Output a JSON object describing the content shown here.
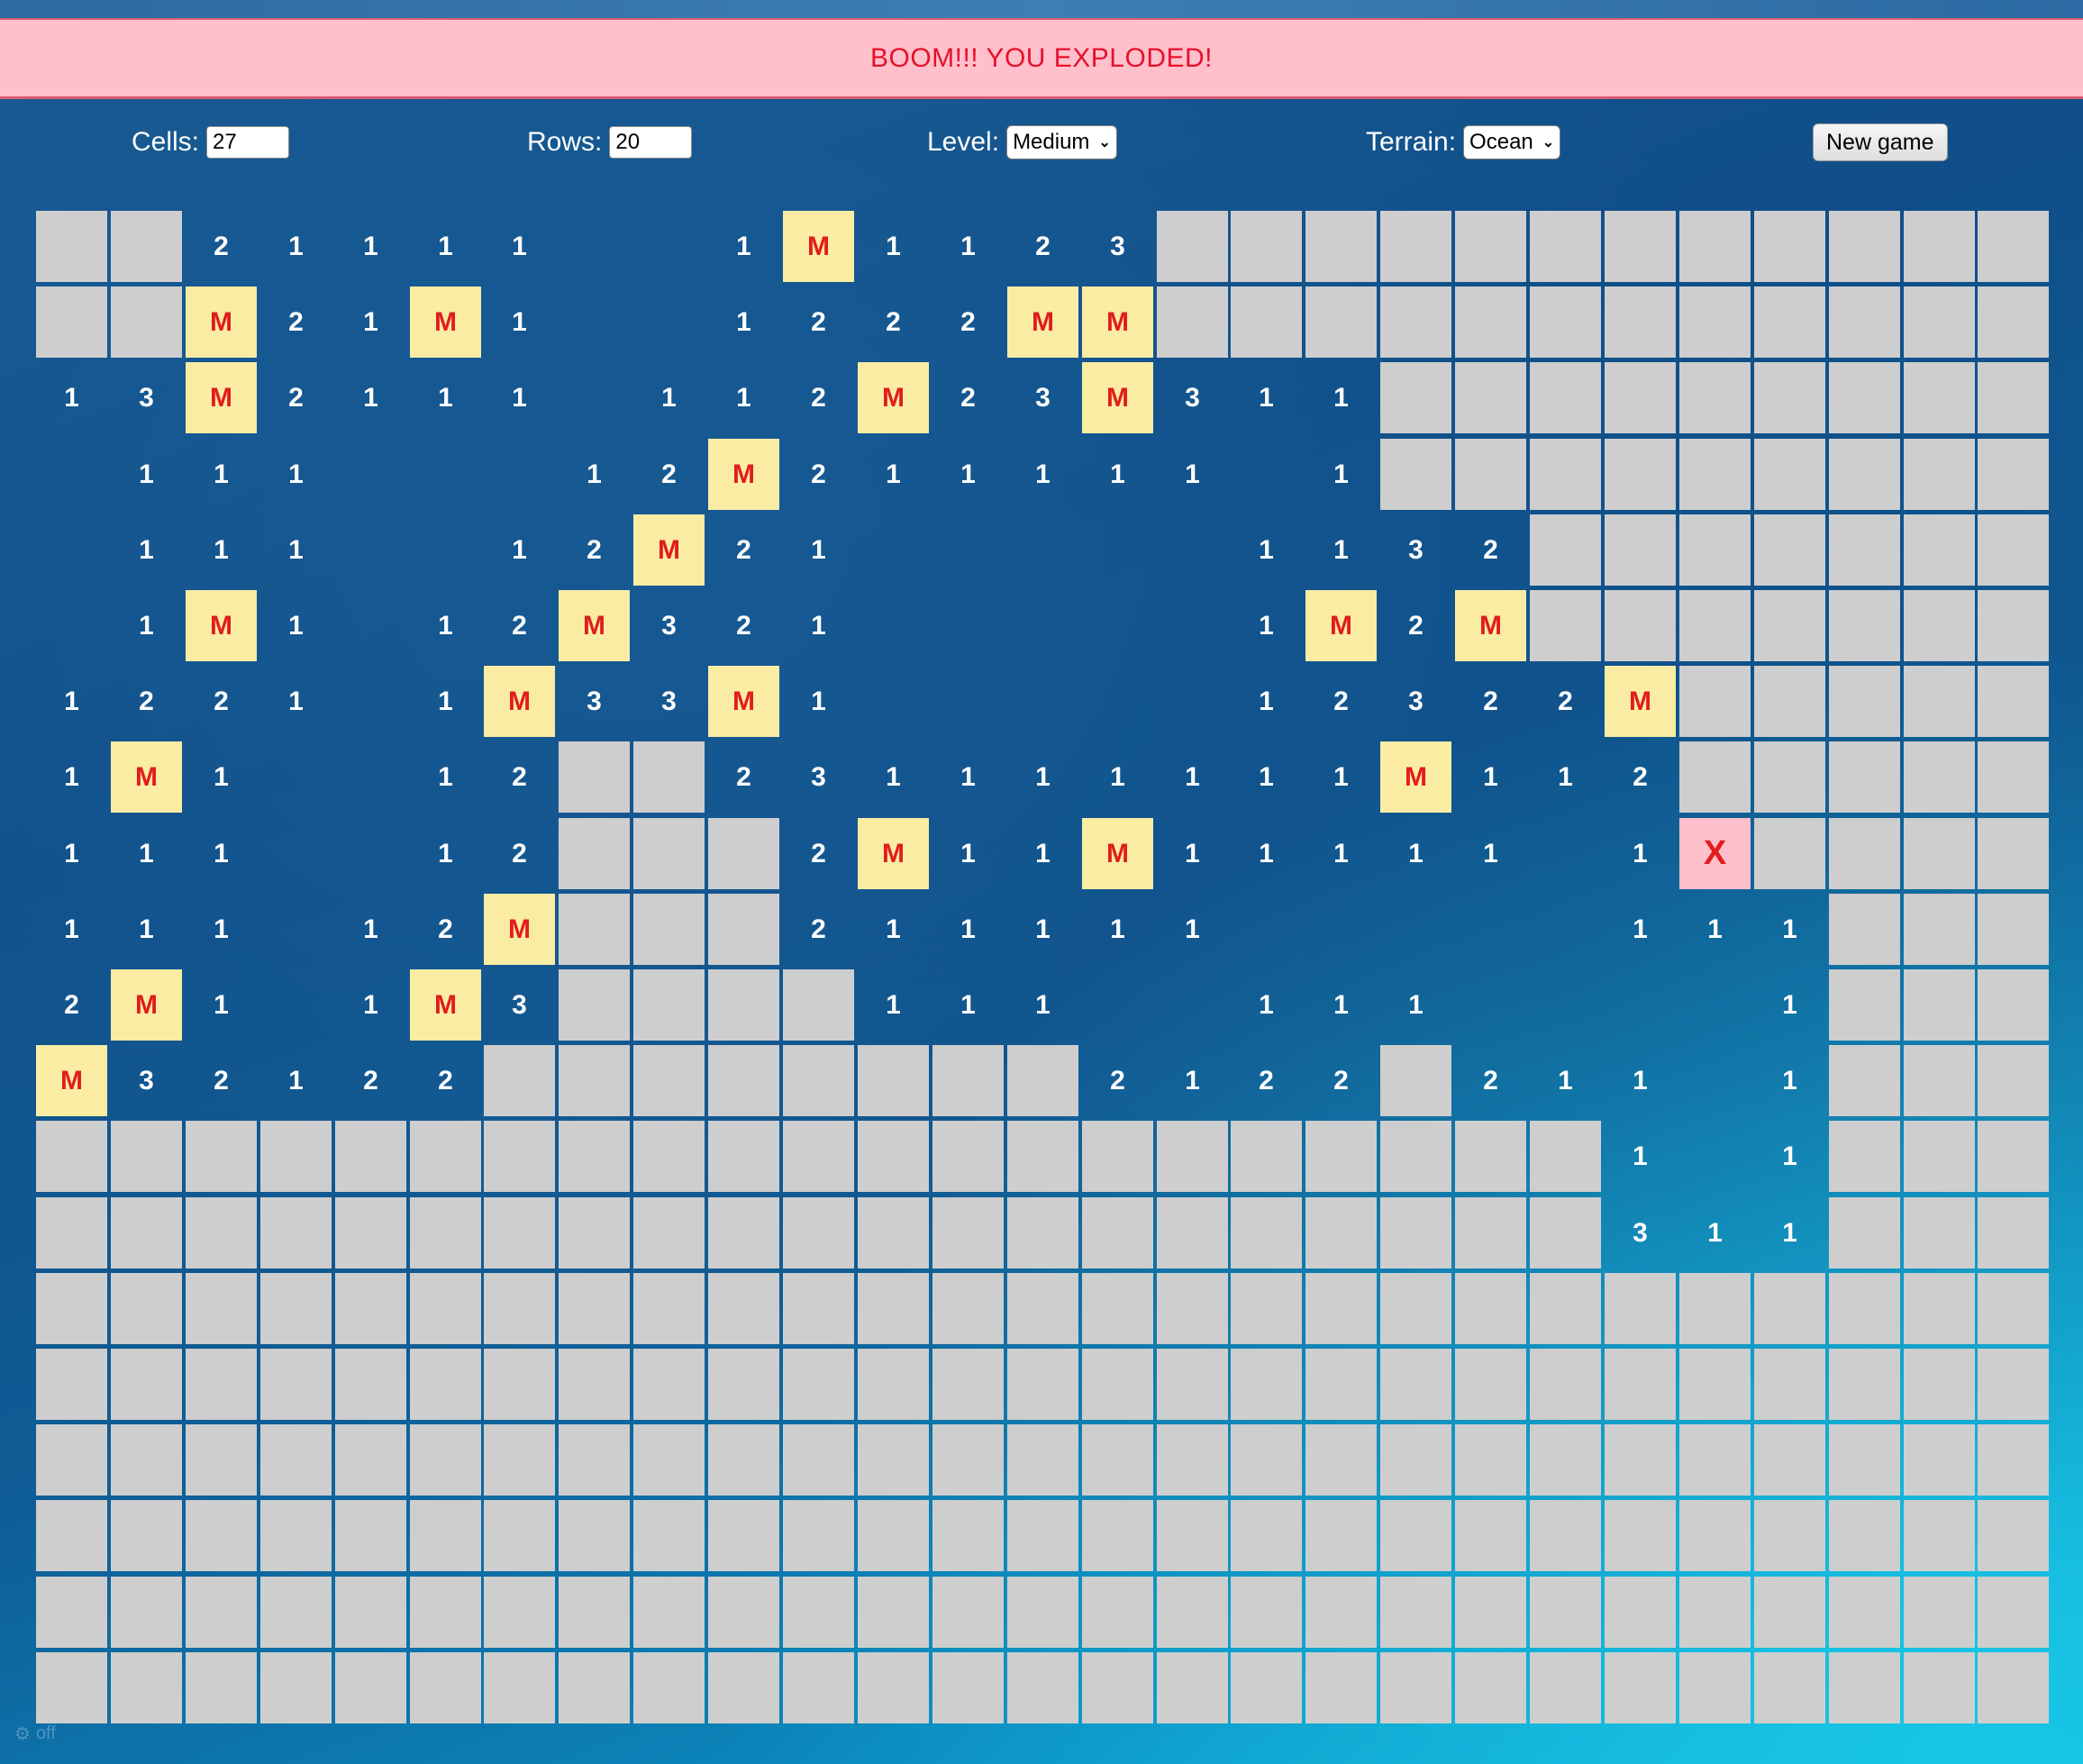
{
  "banner": {
    "message": "BOOM!!! YOU EXPLODED!"
  },
  "controls": {
    "cells_label": "Cells:",
    "cells_value": "27",
    "rows_label": "Rows:",
    "rows_value": "20",
    "level_label": "Level:",
    "level_selected": "Medium",
    "terrain_label": "Terrain:",
    "terrain_selected": "Ocean",
    "new_game_label": "New game"
  },
  "colors": {
    "hidden_cell": "#cecece",
    "mine_cell": "#fbeca4",
    "exploded_cell": "#fdbfcc",
    "mine_text": "#e11d1d",
    "number_text": "#ffffff",
    "banner_bg": "#ffc0cb",
    "banner_text": "#e8102c"
  },
  "board": {
    "cols": 27,
    "rows": 20,
    "legend": {
      "#": "hidden",
      ".": "open-empty",
      "M": "mine",
      "X": "exploded-mine",
      "1-8": "neighbor-count"
    },
    "grid": [
      "##21111..1M1123############",
      "##M21M1..1222MM############",
      "13M2111.112M23M311#########",
      ".111...12M211111.1#########",
      ".111..12M21.....1132#######",
      ".1M1.12M321.....1M2M#######",
      "1221.1M33M1.....12322M#####",
      "1M1..12##231111111M112#####",
      "111..12###2M11M11111.1X####",
      "111.12M###211111.....111###",
      "2M1.1M3####111..111....1###",
      "M32122########2122#211.1###",
      "#####################1.1###",
      "#####################311###",
      "###########################",
      "###########################",
      "###########################",
      "###########################",
      "###########################",
      "###########################"
    ]
  },
  "footer": {
    "status": "off"
  }
}
